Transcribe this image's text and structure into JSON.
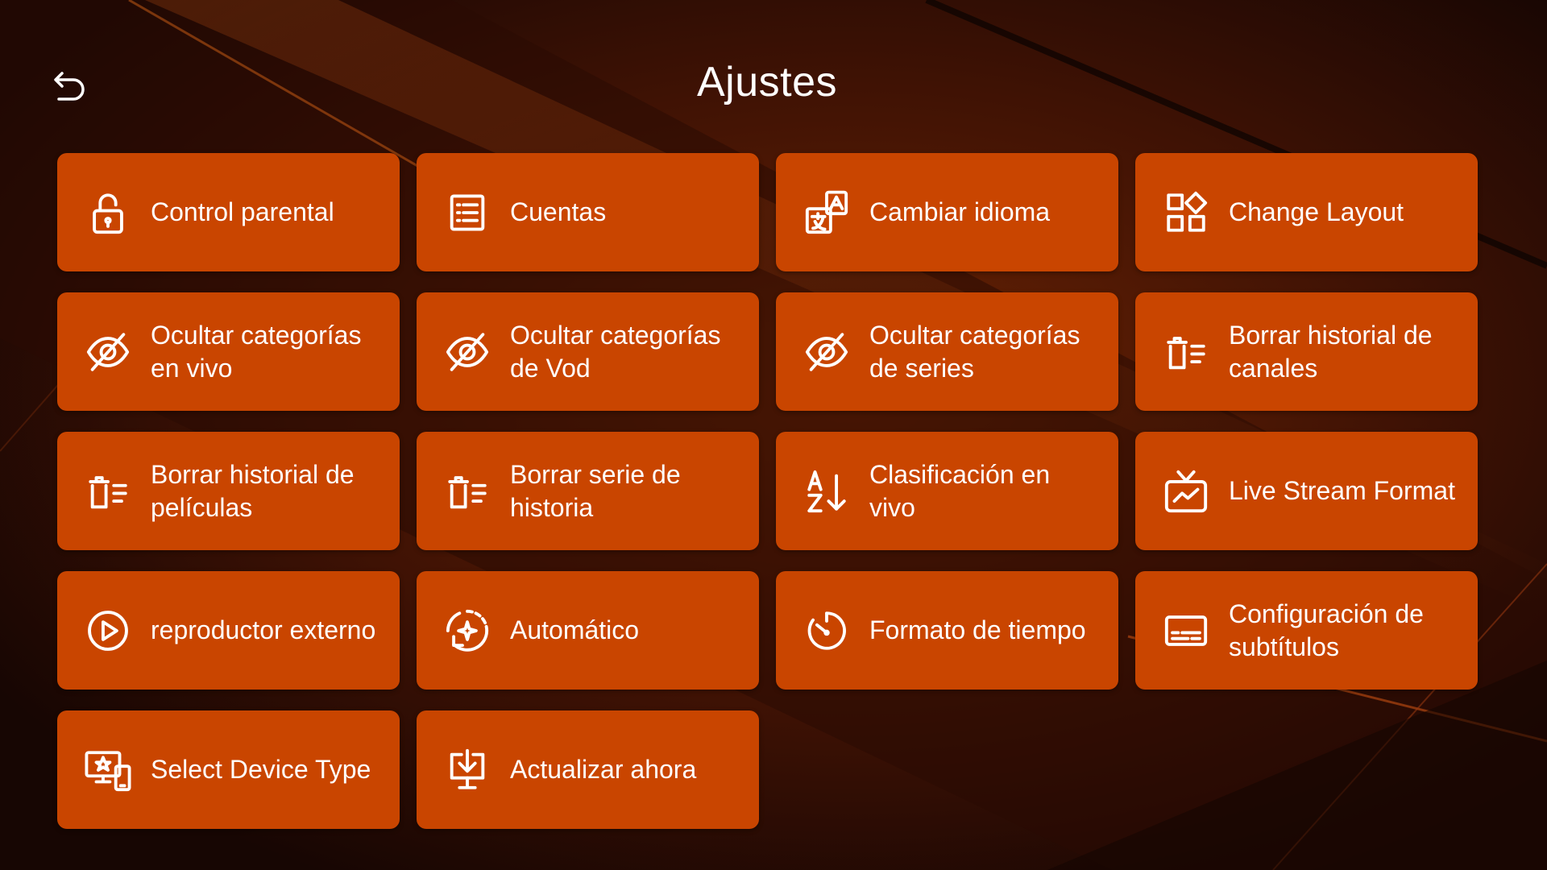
{
  "header": {
    "title": "Ajustes"
  },
  "colors": {
    "tile": "#c94500",
    "background": "#1a0703",
    "text": "#ffffff"
  },
  "tiles": [
    {
      "label": "Control parental",
      "icon": "lock-icon"
    },
    {
      "label": "Cuentas",
      "icon": "list-icon"
    },
    {
      "label": "Cambiar idioma",
      "icon": "translate-icon"
    },
    {
      "label": "Change Layout",
      "icon": "layout-icon"
    },
    {
      "label": "Ocultar categorías en vivo",
      "icon": "eye-off-icon"
    },
    {
      "label": "Ocultar categorías de Vod",
      "icon": "eye-off-icon"
    },
    {
      "label": "Ocultar categorías de series",
      "icon": "eye-off-icon"
    },
    {
      "label": "Borrar historial de canales",
      "icon": "delete-list-icon"
    },
    {
      "label": "Borrar historial de películas",
      "icon": "delete-list-icon"
    },
    {
      "label": "Borrar serie de historia",
      "icon": "delete-list-icon"
    },
    {
      "label": "Clasificación en vivo",
      "icon": "sort-az-icon"
    },
    {
      "label": "Live Stream Format",
      "icon": "tv-icon"
    },
    {
      "label": "reproductor externo",
      "icon": "play-circle-icon"
    },
    {
      "label": "Automático",
      "icon": "auto-sync-icon"
    },
    {
      "label": "Formato de tiempo",
      "icon": "timer-icon"
    },
    {
      "label": "Configuración de subtítulos",
      "icon": "subtitles-icon"
    },
    {
      "label": "Select Device Type",
      "icon": "device-type-icon"
    },
    {
      "label": "Actualizar ahora",
      "icon": "download-update-icon"
    }
  ]
}
